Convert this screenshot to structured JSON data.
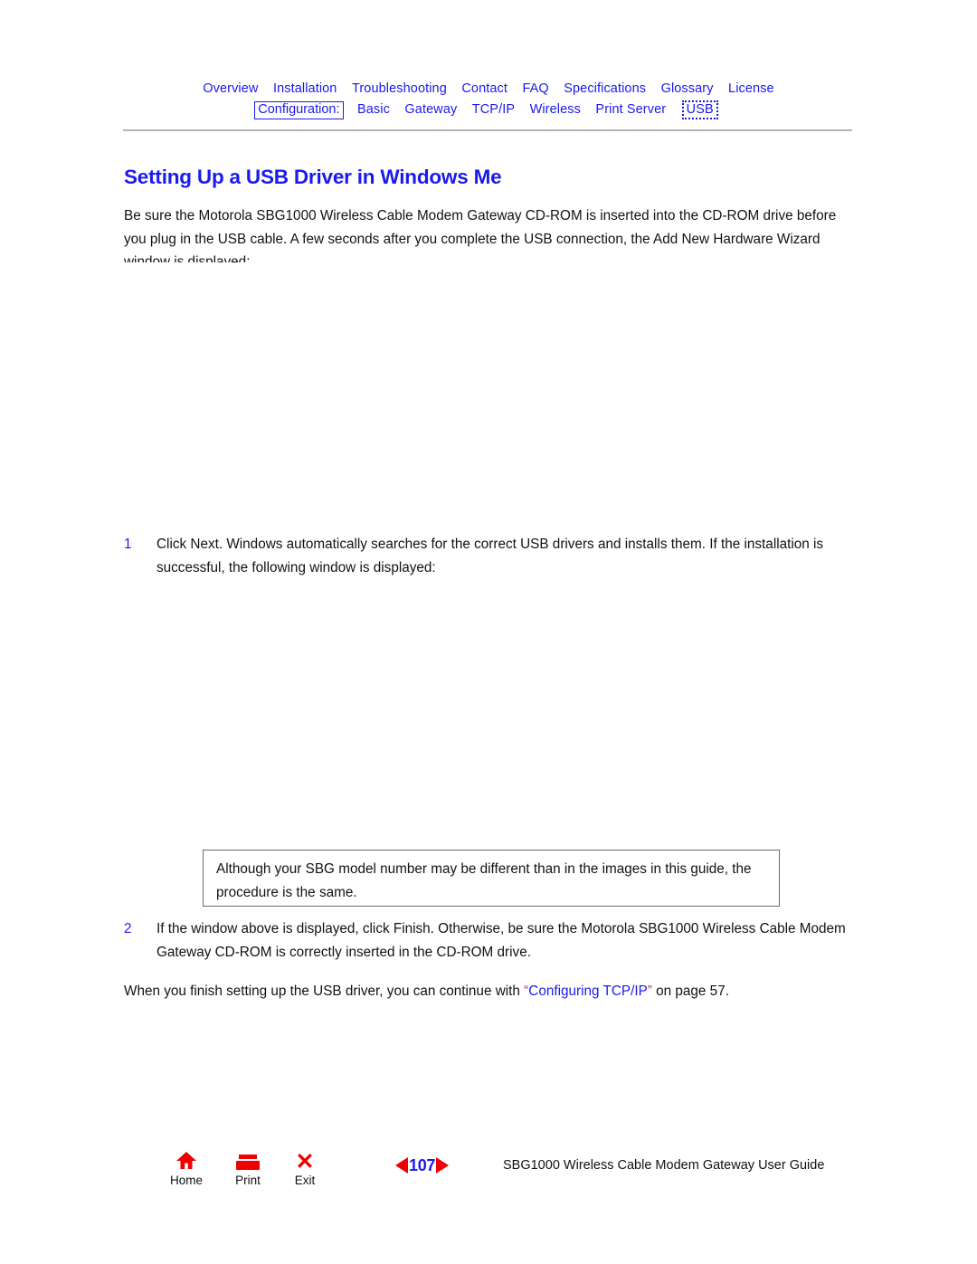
{
  "nav": {
    "row1": [
      {
        "label": "Overview",
        "name": "nav-link-overview"
      },
      {
        "label": "Installation",
        "name": "nav-link-installation"
      },
      {
        "label": "Troubleshooting",
        "name": "nav-link-troubleshooting"
      },
      {
        "label": "Contact",
        "name": "nav-link-contact"
      },
      {
        "label": "FAQ",
        "name": "nav-link-faq"
      },
      {
        "label": "Specifications",
        "name": "nav-link-specifications"
      },
      {
        "label": "Glossary",
        "name": "nav-link-glossary"
      },
      {
        "label": "License",
        "name": "nav-link-license"
      }
    ],
    "section_label": "Configuration:",
    "row2": [
      {
        "label": "Basic",
        "name": "nav-link-basic"
      },
      {
        "label": "Gateway",
        "name": "nav-link-gateway"
      },
      {
        "label": "TCP/IP",
        "name": "nav-link-tcpip"
      },
      {
        "label": "Wireless",
        "name": "nav-link-wireless"
      },
      {
        "label": "Print Server",
        "name": "nav-link-print-server"
      }
    ],
    "current": "USB",
    "link_color": "#1a1aee"
  },
  "heading": {
    "title": "Setting Up a USB Driver in Windows Me"
  },
  "intro": {
    "text": "Be sure the Motorola SBG1000 Wireless Cable Modem Gateway CD-ROM is inserted into the CD-ROM drive before you plug in the USB cable. A few seconds after you complete the USB connection, the Add New Hardware Wizard window is displayed:"
  },
  "steps": [
    {
      "number": "1",
      "text": "Click Next. Windows automatically searches for the correct USB drivers and installs them. If the installation is successful, the following window is displayed:"
    },
    {
      "number": "2",
      "text": "If the window above is displayed, click Finish. Otherwise, be sure the Motorola SBG1000 Wireless Cable Modem Gateway CD-ROM is correctly inserted in the CD-ROM drive."
    }
  ],
  "note": {
    "text": "Although your SBG model number may be different than in the images in this guide, the procedure is the same."
  },
  "closing": {
    "before": "When you finish setting up the USB driver, you can continue with ",
    "open_quote": "“",
    "link": "Configuring TCP/IP",
    "close_quote": "”",
    "after": " on page 57."
  },
  "footer": {
    "tools": [
      {
        "caption": "Home",
        "icon": "home-icon"
      },
      {
        "caption": "Print",
        "icon": "printer-icon"
      },
      {
        "caption": "Exit",
        "icon": "close-x-icon"
      }
    ],
    "page_number": "107",
    "guide_title": "SBG1000 Wireless Cable Modem Gateway User Guide",
    "accent_red": "#ee0000",
    "accent_blue": "#1a1aee"
  }
}
